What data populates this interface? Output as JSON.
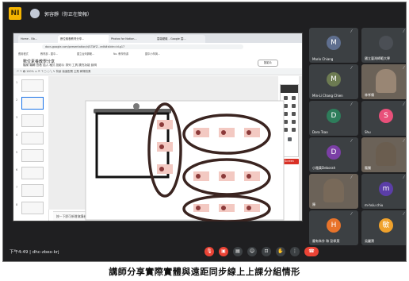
{
  "meet": {
    "logo": "NI",
    "presenter": "郭容靜（你正在簡報）",
    "meeting_time": "下午4:49",
    "meeting_code": "dhc-zbex-krj"
  },
  "browser": {
    "tabs": [
      "Home - Bb... ",
      "數位素養教育分享...",
      "Photos for Nation...",
      "雲端硬碟 - Google 雲..."
    ],
    "url": "docs.google.com/presentation/d/1TAYZ...edit#slide=id.g17",
    "bookmarks": [
      "應用程式",
      "教育部 - 國中...",
      "國立台灣師範...",
      "No. 教學資源",
      "國中小學與..."
    ]
  },
  "slides": {
    "doc_title": "數位素養教學分享",
    "menu": "檔案  編輯  查看  插入  格式  投影片  排列  工具  擴充功能  說明",
    "slideshow_label": "投影片",
    "toolbar_text": "↶ ↷ 🖶  100%  ▭  ⇱  T  ▢  ○  ╲  ✎    背景   版面配置   主題   轉場效果",
    "speaker_note": "按一下即可新增演講者備忘稿",
    "draw_label": "Screen"
  },
  "participants": [
    {
      "name": "Mario Chiang",
      "initial": "M",
      "color": "#5f6f8f",
      "video": false
    },
    {
      "name": "國立臺灣師範大學",
      "initial": "",
      "color": "#4b4f55",
      "video": false
    },
    {
      "name": "Min-Li Chang Chien",
      "initial": "M",
      "color": "#6d7b52",
      "video": false
    },
    {
      "name": "林孝儒",
      "initial": "",
      "color": "#9e8b78",
      "video": true
    },
    {
      "name": "Dora Tsao",
      "initial": "D",
      "color": "#2e7d5b",
      "video": false
    },
    {
      "name": "Shu",
      "initial": "S",
      "color": "#e8507a",
      "video": false
    },
    {
      "name": "小雅黃Deborah",
      "initial": "D",
      "color": "#7b3fa6",
      "video": false
    },
    {
      "name": "龍騰",
      "initial": "",
      "color": "#6a5d4f",
      "video": true
    },
    {
      "name": "陳",
      "initial": "",
      "color": "#7a6a5a",
      "video": true
    },
    {
      "name": "m-hsiu chiu",
      "initial": "m",
      "color": "#5b3ea8",
      "video": false
    },
    {
      "name": "龐有朱外 和 彭佩賢",
      "initial": "H",
      "color": "#e8732a",
      "video": false
    },
    {
      "name": "吳麗寶",
      "initial": "敏",
      "color": "#f0a22c",
      "video": false
    }
  ],
  "caption": "講師分享實際實體與遠距同步線上上課分組情形"
}
